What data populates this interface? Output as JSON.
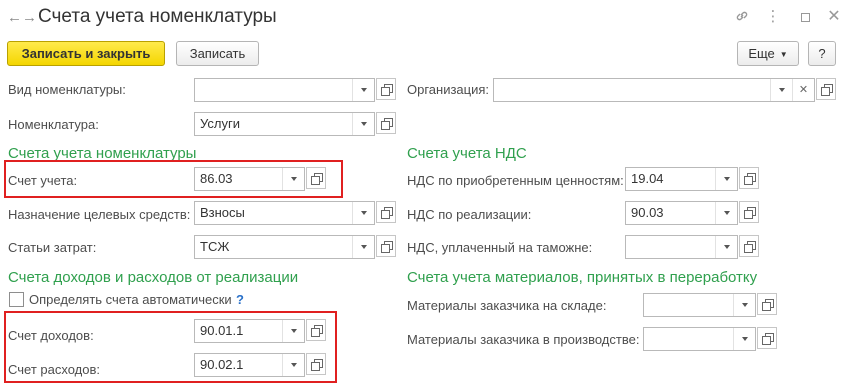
{
  "window": {
    "title": "Счета учета номенклатуры",
    "back_glyph": "←",
    "forward_glyph": "→",
    "link_glyph": "🔗",
    "menu_glyph": "⋮",
    "close_glyph": "✕"
  },
  "toolbar": {
    "save_close_label": "Записать и закрыть",
    "save_label": "Записать",
    "more_label": "Еще",
    "help_label": "?"
  },
  "top": {
    "vid_label": "Вид номенклатуры:",
    "vid_value": "",
    "org_label": "Организация:",
    "org_value": "",
    "nom_label": "Номенклатура:",
    "nom_value": "Услуги"
  },
  "nomenclature_accounts": {
    "header": "Счета учета номенклатуры",
    "account_label": "Счет учета:",
    "account_value": "86.03",
    "purpose_label": "Назначение целевых средств:",
    "purpose_value": "Взносы",
    "costs_label": "Статьи затрат:",
    "costs_value": "ТСЖ"
  },
  "vat_accounts": {
    "header": "Счета учета НДС",
    "purchased_label": "НДС по приобретенным ценностям:",
    "purchased_value": "19.04",
    "sales_label": "НДС по реализации:",
    "sales_value": "90.03",
    "customs_label": "НДС, уплаченный на таможне:",
    "customs_value": ""
  },
  "income_expense": {
    "header": "Счета доходов и расходов от реализации",
    "auto_label": "Определять счета автоматически",
    "auto_checked": false,
    "help_glyph": "?",
    "income_label": "Счет доходов:",
    "income_value": "90.01.1",
    "expense_label": "Счет расходов:",
    "expense_value": "90.02.1"
  },
  "materials": {
    "header": "Счета учета материалов, принятых в переработку",
    "warehouse_label": "Материалы заказчика на складе:",
    "warehouse_value": "",
    "production_label": "Материалы заказчика в производстве:",
    "production_value": ""
  },
  "colors": {
    "section_green": "#30a04e",
    "highlight_red": "#e02020",
    "primary_yellow": "#f4d600"
  }
}
